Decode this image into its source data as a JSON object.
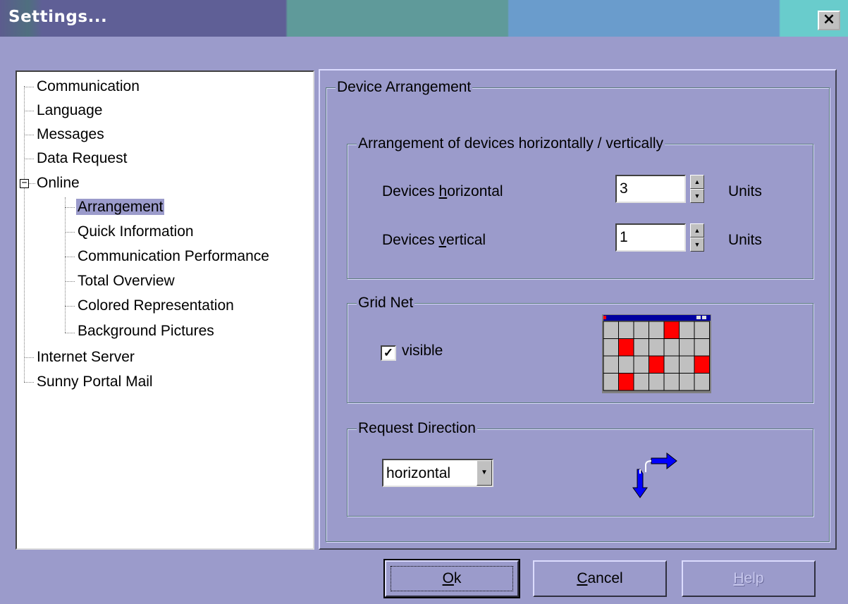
{
  "window": {
    "title": "Settings...",
    "close_label": "×"
  },
  "tree": {
    "items": [
      {
        "label": "Communication"
      },
      {
        "label": "Language"
      },
      {
        "label": "Messages"
      },
      {
        "label": "Data Request"
      },
      {
        "label": "Online",
        "expanded": true
      },
      {
        "label": "Arrangement",
        "selected": true
      },
      {
        "label": "Quick Information"
      },
      {
        "label": "Communication Performance"
      },
      {
        "label": "Total Overview"
      },
      {
        "label": "Colored Representation"
      },
      {
        "label": "Background Pictures"
      },
      {
        "label": "Internet Server"
      },
      {
        "label": "Sunny Portal Mail"
      }
    ],
    "expander_symbol": "−"
  },
  "panel": {
    "title": "Device Arrangement",
    "arrangement": {
      "title": "Arrangement of devices horizontally / vertically",
      "horizontal": {
        "label_pre": "Devices ",
        "label_mnemonic": "h",
        "label_post": "orizontal",
        "value": "3",
        "unit": "Units"
      },
      "vertical": {
        "label_pre": "Devices ",
        "label_mnemonic": "v",
        "label_post": "ertical",
        "value": "1",
        "unit": "Units"
      }
    },
    "grid": {
      "title": "Grid Net",
      "checkbox_label": "visible",
      "checked": true,
      "check_mark": "✓",
      "preview_red_cells": [
        [
          0,
          4
        ],
        [
          1,
          1
        ],
        [
          2,
          3
        ],
        [
          2,
          6
        ],
        [
          3,
          1
        ]
      ]
    },
    "request": {
      "title": "Request Direction",
      "selected": "horizontal"
    }
  },
  "buttons": {
    "ok": {
      "mnemonic": "O",
      "rest": "k"
    },
    "cancel": {
      "mnemonic": "C",
      "rest": "ancel"
    },
    "help": {
      "mnemonic": "H",
      "rest": "elp"
    }
  },
  "colors": {
    "background": "#9b9bcb",
    "selection": "#9b9bcb",
    "preview_red": "#ff0000",
    "preview_cell": "#c0c0c0",
    "arrow_blue": "#0000ff"
  }
}
